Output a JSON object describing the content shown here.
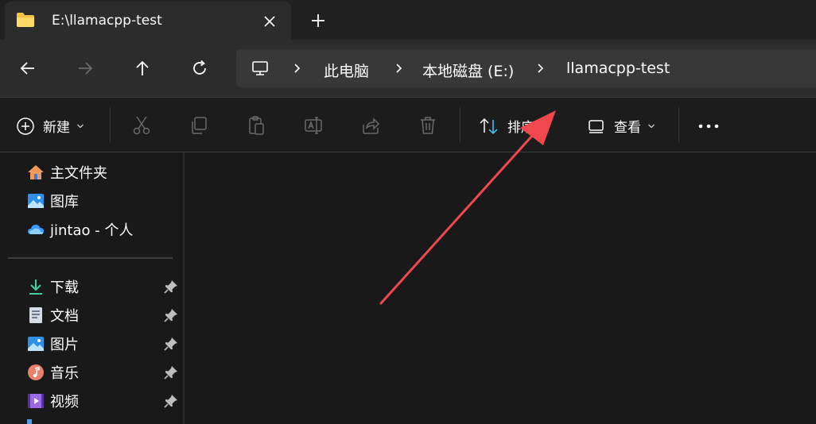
{
  "tab": {
    "title": "E:\\llamacpp-test"
  },
  "breadcrumb": [
    "此电脑",
    "本地磁盘 (E:)",
    "llamacpp-test"
  ],
  "commands": {
    "new_label": "新建",
    "sort_label": "排序",
    "view_label": "查看"
  },
  "sidebar": {
    "quick": [
      {
        "label": "主文件夹",
        "icon": "home-icon"
      },
      {
        "label": "图库",
        "icon": "gallery-icon"
      },
      {
        "label": "jintao - 个人",
        "icon": "onedrive-cloud-icon"
      }
    ],
    "pinned": [
      {
        "label": "下载",
        "icon": "download-icon"
      },
      {
        "label": "文档",
        "icon": "document-icon"
      },
      {
        "label": "图片",
        "icon": "pictures-icon"
      },
      {
        "label": "音乐",
        "icon": "music-icon"
      },
      {
        "label": "视频",
        "icon": "video-icon"
      }
    ]
  },
  "colors": {
    "accent": "#4cc2ff",
    "annotation_arrow": "#f0484c",
    "folder": "#f4c542"
  }
}
